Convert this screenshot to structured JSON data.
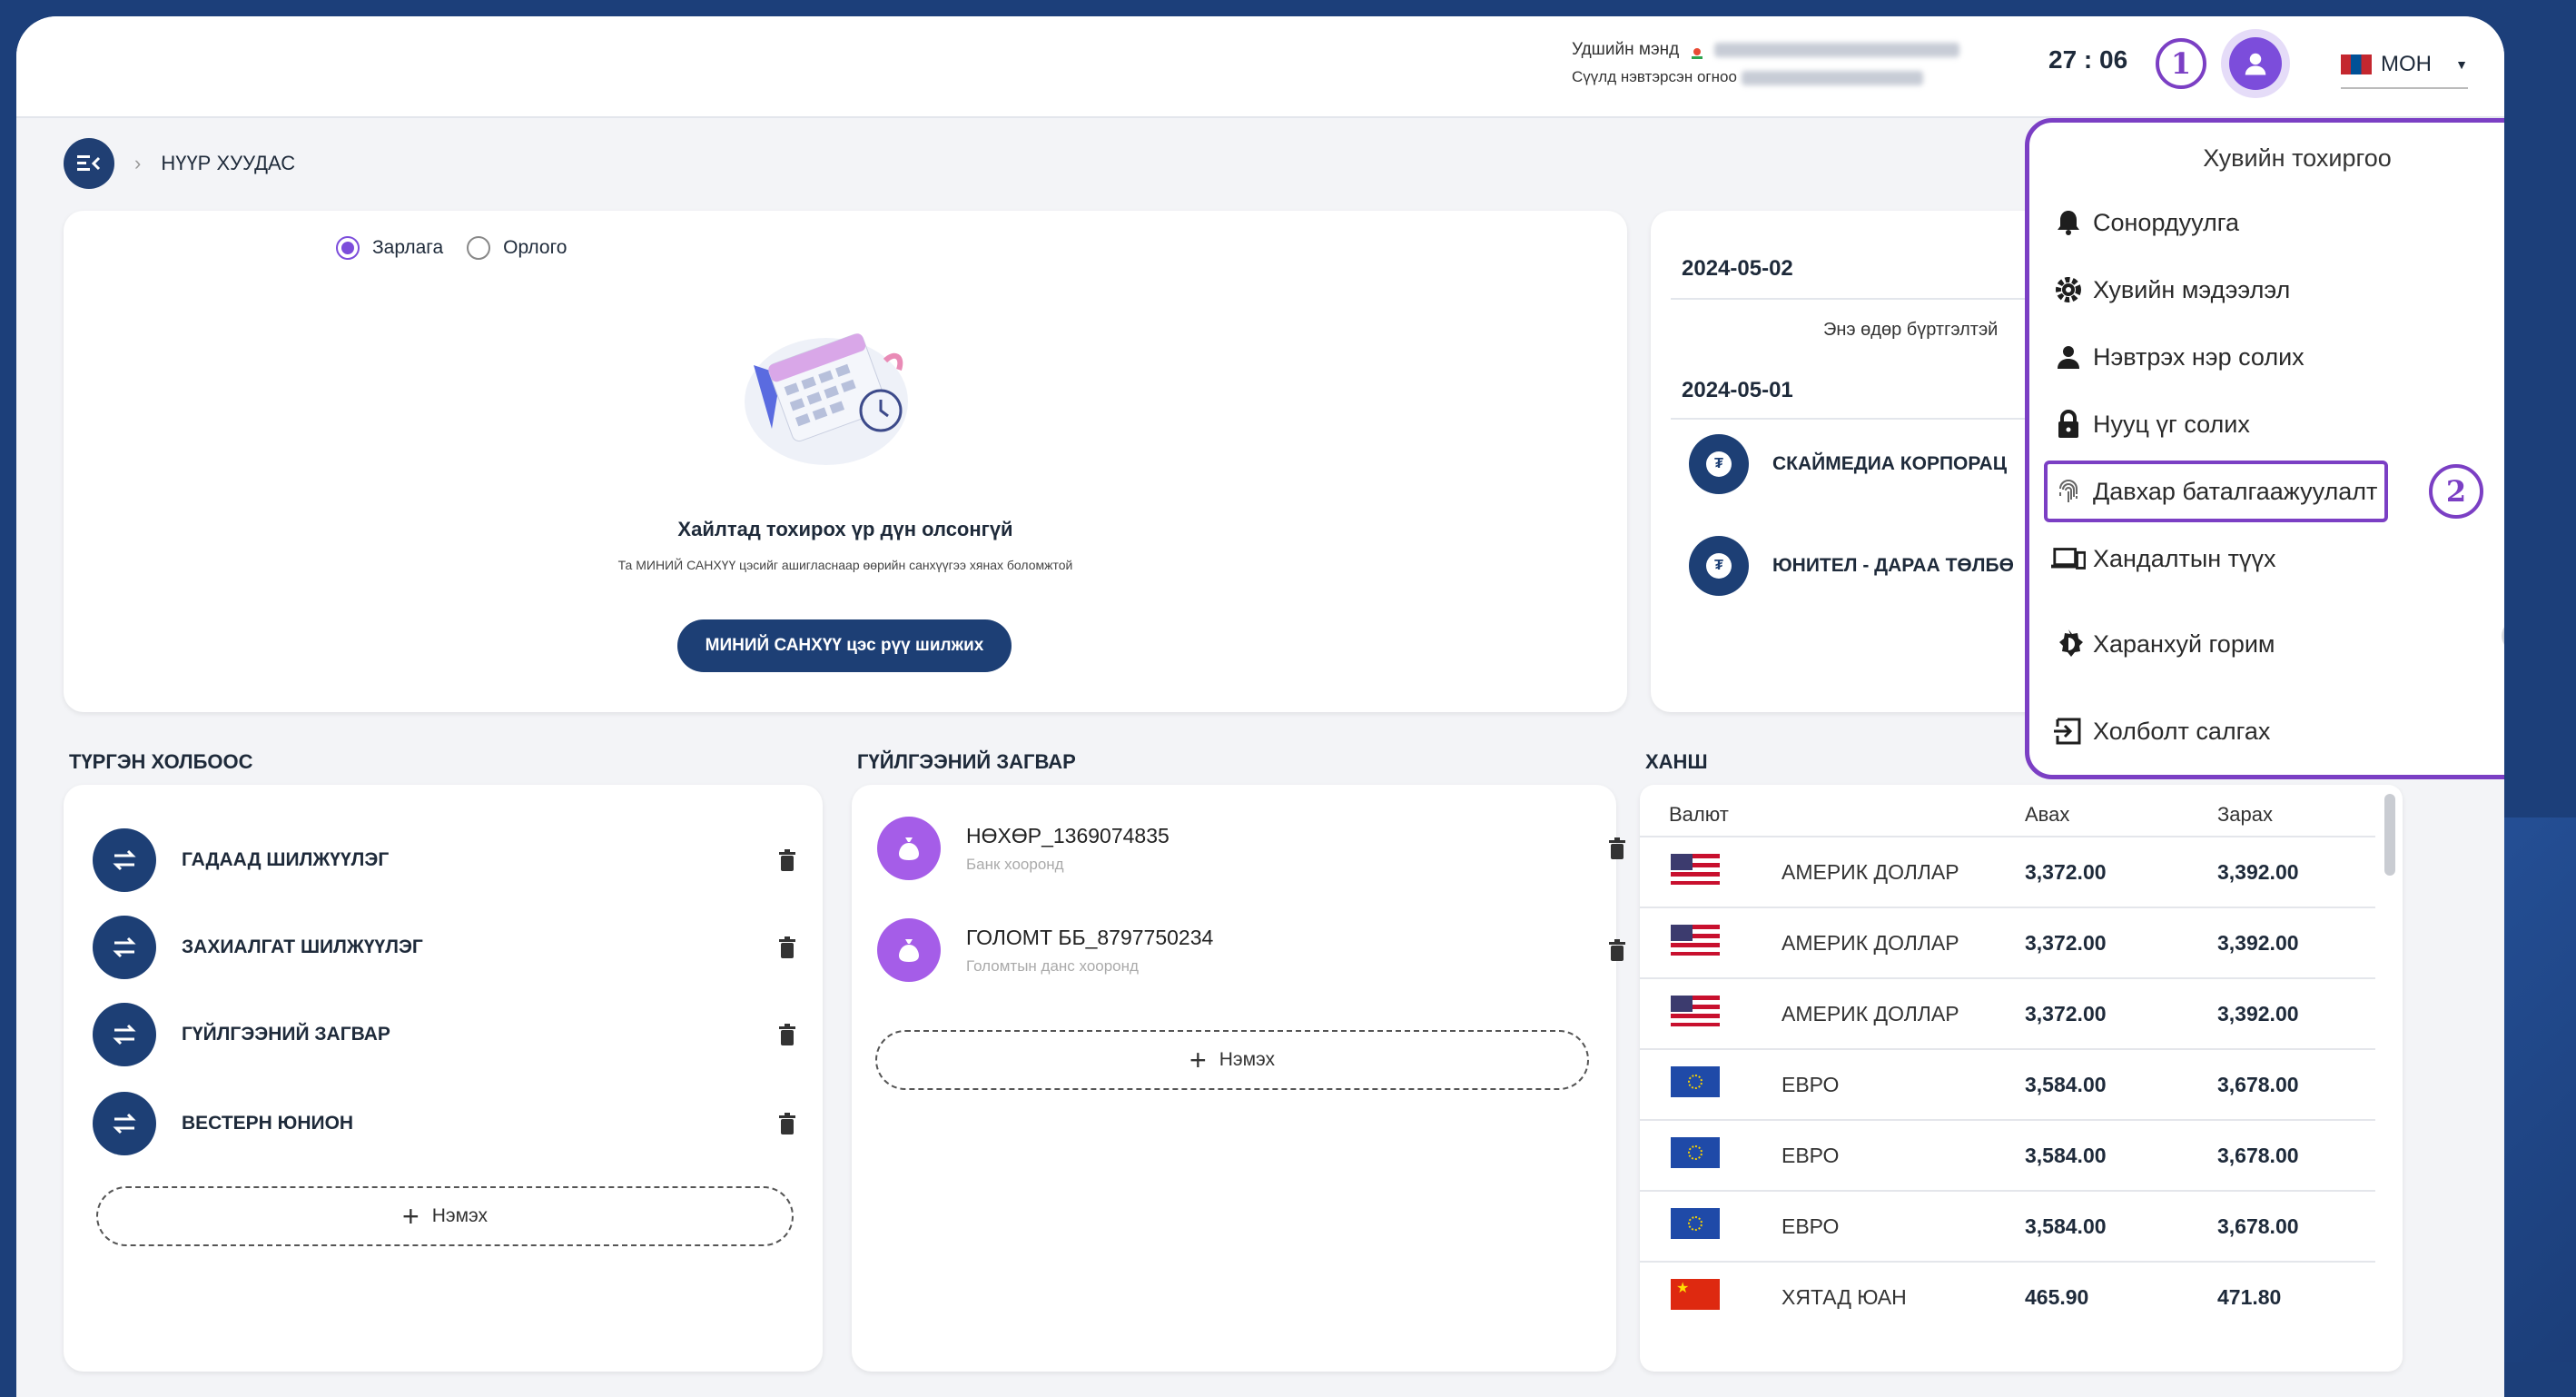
{
  "header": {
    "greeting": "Удшийн мэнд",
    "last_login_label": "Сүүлд нэвтэрсэн огноо",
    "timer": "27 : 06",
    "language": "МОН",
    "markers": [
      "1",
      "2"
    ]
  },
  "breadcrumb": {
    "current": "НҮҮР ХУУДАС"
  },
  "expense_card": {
    "radio_expense": "Зарлага",
    "radio_income": "Орлого",
    "selected": "Зарлага",
    "empty_title": "Хайлтад тохирох үр дүн олсонгүй",
    "empty_subtitle": "Та МИНИЙ САНХҮҮ цэсийг ашигласнаар өөрийн санхүүгээ хянах боломжтой",
    "button_label": "МИНИЙ САНХҮҮ цэс рүү шилжих"
  },
  "transactions": {
    "date1": "2024-05-02",
    "note1": "Энэ өдөр бүртгэлтэй",
    "date2": "2024-05-01",
    "items": [
      "СКАЙМЕДИА КОРПОРАЦ",
      "ЮНИТЕЛ - ДАРАА ТӨЛБӨ"
    ]
  },
  "quick_links": {
    "title": "ТҮРГЭН ХОЛБООС",
    "items": [
      "ГАДААД ШИЛЖҮҮЛЭГ",
      "ЗАХИАЛГАТ ШИЛЖҮҮЛЭГ",
      "ГҮЙЛГЭЭНИЙ ЗАГВАР",
      "ВЕСТЕРН ЮНИОН"
    ],
    "add_label": "Нэмэх"
  },
  "templates": {
    "title": "ГҮЙЛГЭЭНИЙ ЗАГВАР",
    "items": [
      {
        "name": "НӨХӨР_1369074835",
        "sub": "Банк хооронд"
      },
      {
        "name": "ГОЛОМТ ББ_8797750234",
        "sub": "Голомтын данс хооронд"
      }
    ],
    "add_label": "Нэмэх"
  },
  "rates": {
    "title": "ХАНШ",
    "col_currency": "Валют",
    "col_buy": "Авах",
    "col_sell": "Зарах",
    "rows": [
      {
        "flag": "us",
        "name": "АМЕРИК ДОЛЛАР",
        "buy": "3,372.00",
        "sell": "3,392.00"
      },
      {
        "flag": "us",
        "name": "АМЕРИК ДОЛЛАР",
        "buy": "3,372.00",
        "sell": "3,392.00"
      },
      {
        "flag": "us",
        "name": "АМЕРИК ДОЛЛАР",
        "buy": "3,372.00",
        "sell": "3,392.00"
      },
      {
        "flag": "eu",
        "name": "ЕВРО",
        "buy": "3,584.00",
        "sell": "3,678.00"
      },
      {
        "flag": "eu",
        "name": "ЕВРО",
        "buy": "3,584.00",
        "sell": "3,678.00"
      },
      {
        "flag": "eu",
        "name": "ЕВРО",
        "buy": "3,584.00",
        "sell": "3,678.00"
      },
      {
        "flag": "cn",
        "name": "ХЯТАД ЮАН",
        "buy": "465.90",
        "sell": "471.80"
      }
    ]
  },
  "settings_menu": {
    "title": "Хувийн тохиргоо",
    "items": [
      {
        "label": "Сонордуулга",
        "icon": "bell-icon"
      },
      {
        "label": "Хувийн мэдээлэл",
        "icon": "gear-icon"
      },
      {
        "label": "Нэвтрэх нэр солих",
        "icon": "user-icon"
      },
      {
        "label": "Нууц үг солих",
        "icon": "lock-icon"
      },
      {
        "label": "Давхар баталгаажуулалт",
        "icon": "fingerprint-icon"
      },
      {
        "label": "Хандалтын түүх",
        "icon": "devices-icon"
      },
      {
        "label": "Харанхуй горим",
        "icon": "contrast-icon"
      },
      {
        "label": "Холболт салгах",
        "icon": "logout-icon"
      }
    ]
  },
  "colors": {
    "primary": "#1d3f75",
    "accent": "#7c4ddb",
    "highlight": "#7b3fc4"
  }
}
